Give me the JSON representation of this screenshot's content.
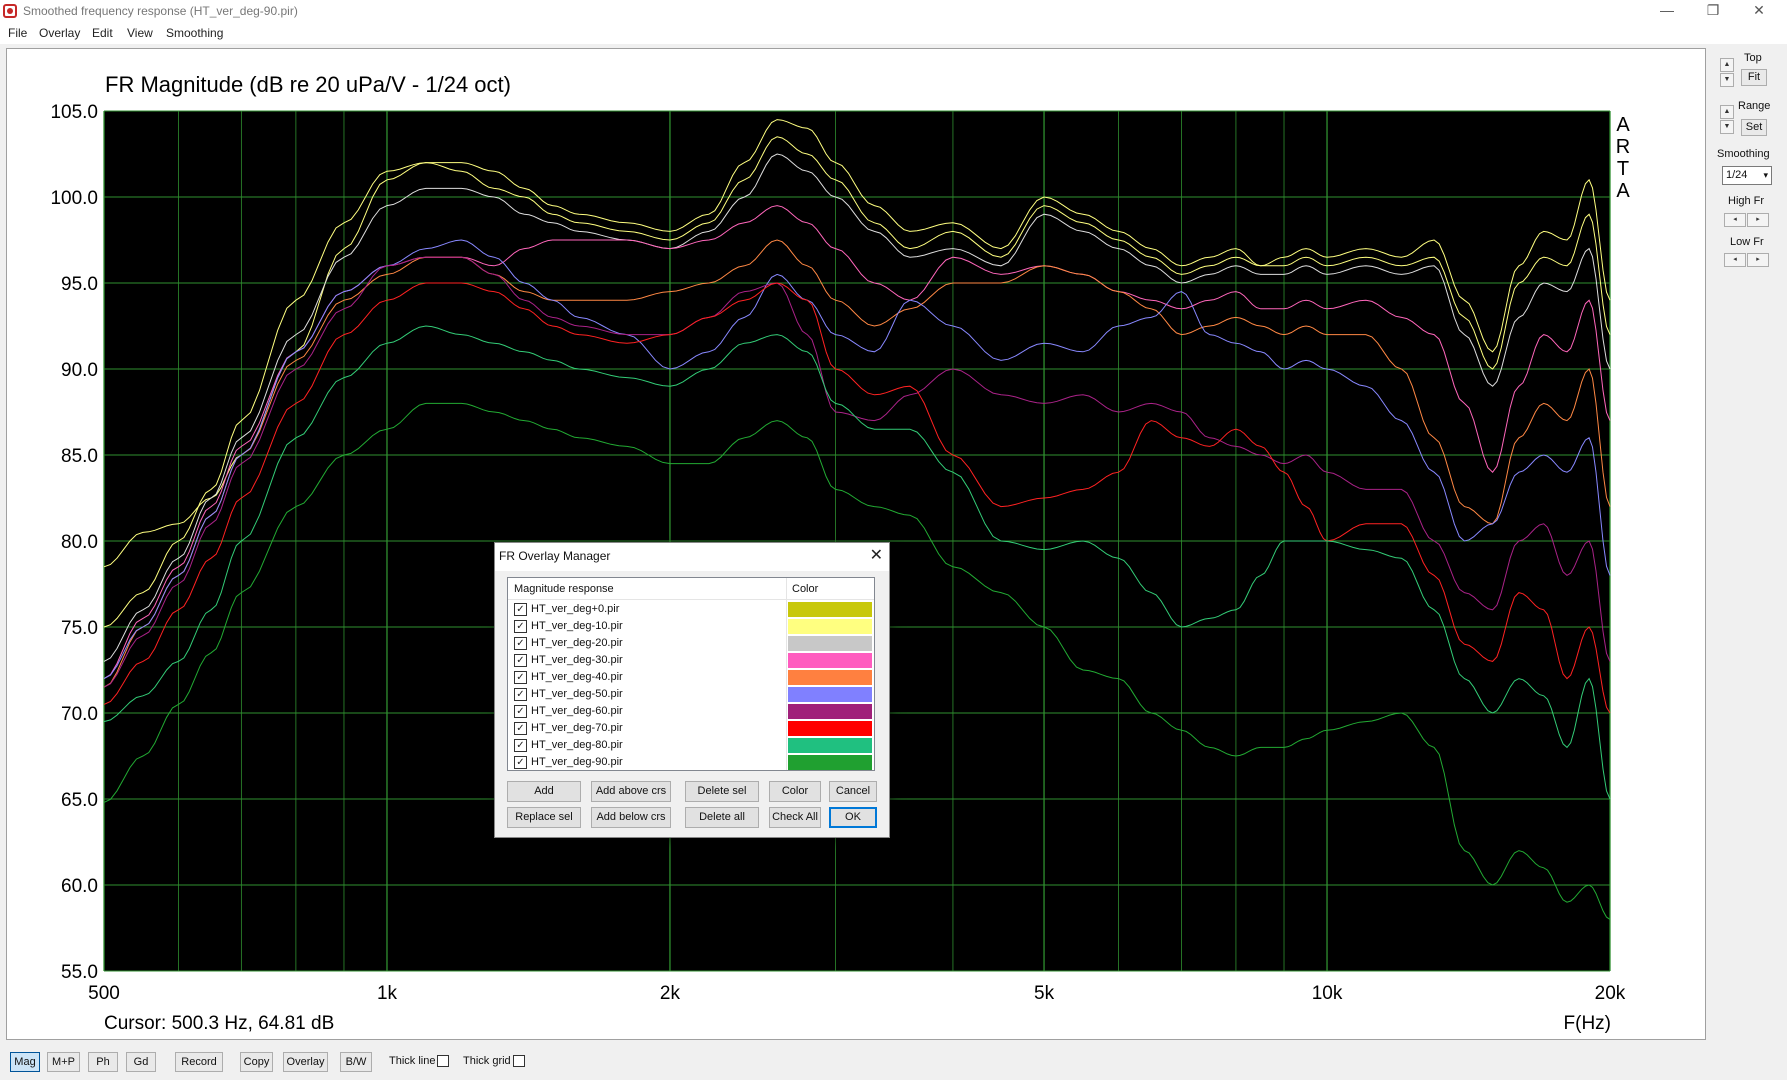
{
  "window": {
    "title": "Smoothed frequency response (HT_ver_deg-90.pir)",
    "controls": [
      "—",
      "❐",
      "✕"
    ]
  },
  "menu": [
    "File",
    "Overlay",
    "Edit",
    "View",
    "Smoothing"
  ],
  "chart_data": {
    "type": "line",
    "title": "FR Magnitude (dB re 20 uPa/V - 1/24 oct)",
    "watermark": "ARTA",
    "xlabel": "F(Hz)",
    "ylabel": "",
    "x_scale": "log",
    "xlim": [
      500,
      20000
    ],
    "ylim": [
      55,
      105
    ],
    "x_ticks": [
      500,
      1000,
      2000,
      5000,
      10000,
      20000
    ],
    "x_tick_labels": [
      "500",
      "1k",
      "2k",
      "5k",
      "10k",
      "20k"
    ],
    "y_ticks": [
      55,
      60,
      65,
      70,
      75,
      80,
      85,
      90,
      95,
      100,
      105
    ],
    "y_tick_labels": [
      "55.0",
      "60.0",
      "65.0",
      "70.0",
      "75.0",
      "80.0",
      "85.0",
      "90.0",
      "95.0",
      "100.0",
      "105.0"
    ],
    "grid": true,
    "background": "#000000",
    "grid_color": "#2f8f2f",
    "cursor_text": "Cursor: 500.3 Hz, 64.81 dB",
    "x": [
      500,
      550,
      600,
      650,
      700,
      800,
      900,
      1000,
      1100,
      1200,
      1300,
      1400,
      1500,
      1600,
      1800,
      2000,
      2200,
      2400,
      2600,
      2800,
      3000,
      3300,
      3600,
      4000,
      4500,
      5000,
      5500,
      6000,
      6500,
      7000,
      7500,
      8000,
      8500,
      9000,
      9500,
      10000,
      11000,
      12000,
      13000,
      14000,
      15000,
      16000,
      17000,
      18000,
      19000,
      20000
    ],
    "series": [
      {
        "name": "HT_ver_deg+0.pir",
        "color": "#ffff80",
        "values": [
          78.5,
          80.5,
          81,
          82.5,
          85,
          91,
          97,
          101,
          102,
          102,
          101.5,
          100.5,
          99.5,
          99,
          98.5,
          98,
          99,
          102,
          104.5,
          104,
          102,
          99.5,
          98,
          98.5,
          97,
          100,
          99,
          98,
          97,
          96,
          96.5,
          97,
          96,
          96.5,
          97,
          96.5,
          97,
          96.5,
          97.5,
          94,
          91,
          96,
          98,
          97.5,
          101,
          94
        ]
      },
      {
        "name": "HT_ver_deg-10.pir",
        "color": "#ffff80",
        "values": [
          75,
          77,
          80,
          83,
          87,
          94,
          98.5,
          101.5,
          102,
          101.5,
          100.5,
          100,
          99,
          98.5,
          98,
          97.5,
          98.5,
          101,
          103.5,
          102.5,
          101,
          98.5,
          97,
          98,
          96.5,
          99.5,
          98.5,
          97.5,
          96.5,
          95.5,
          96,
          96.5,
          96,
          96,
          96.5,
          96,
          96.5,
          96,
          96.5,
          93,
          90,
          95,
          96.5,
          96,
          99,
          92
        ]
      },
      {
        "name": "HT_ver_deg-20.pir",
        "color": "#dddddd",
        "values": [
          73,
          76,
          79,
          82.5,
          86,
          92,
          96.5,
          99.5,
          100.5,
          100.5,
          100,
          99,
          98.5,
          98,
          97.5,
          97,
          98,
          100,
          102.5,
          101.5,
          100,
          98,
          96.5,
          97,
          96,
          99,
          98,
          97,
          96,
          95,
          95.5,
          96,
          95.5,
          95.5,
          96,
          95.5,
          96,
          95.5,
          96,
          92,
          89,
          93,
          95,
          94.5,
          97,
          90
        ]
      },
      {
        "name": "HT_ver_deg-30.pir",
        "color": "#ff66bb",
        "values": [
          72,
          75.5,
          78.5,
          82,
          85.5,
          91,
          94.5,
          96,
          96.5,
          96.5,
          96,
          97,
          97.5,
          97.5,
          97.5,
          97,
          97.5,
          98.5,
          99.5,
          98.5,
          97,
          95,
          94,
          96.5,
          95.5,
          96,
          95.5,
          94.5,
          94,
          93.5,
          94,
          94.5,
          93.5,
          93.5,
          94,
          93.5,
          94,
          93,
          92,
          88,
          84,
          89,
          92,
          91,
          94,
          87
        ]
      },
      {
        "name": "HT_ver_deg-40.pir",
        "color": "#ff8844",
        "values": [
          71.5,
          75,
          78,
          81.5,
          85,
          90.5,
          94,
          95.5,
          96.5,
          96.5,
          95.5,
          94.5,
          94,
          94,
          94,
          94.5,
          95,
          96,
          97.5,
          96,
          94,
          92.5,
          93.5,
          95,
          95,
          96,
          95.5,
          94.5,
          93.5,
          92,
          92.5,
          93,
          92.5,
          92,
          92.5,
          92,
          92,
          90,
          86,
          82,
          81,
          86,
          88,
          87,
          90,
          82
        ]
      },
      {
        "name": "HT_ver_deg-50.pir",
        "color": "#8888ff",
        "values": [
          72,
          75,
          78,
          81.5,
          85,
          91,
          94.5,
          96,
          97,
          97.5,
          96.5,
          95,
          94,
          93,
          92,
          90,
          91,
          93,
          95.5,
          94,
          92,
          91,
          94,
          92.5,
          90.5,
          91.5,
          91,
          92.5,
          93,
          94.5,
          92,
          91.5,
          91,
          90,
          90.5,
          90,
          89,
          87,
          84,
          80,
          81,
          84,
          85,
          84,
          86,
          78
        ]
      },
      {
        "name": "HT_ver_deg-60.pir",
        "color": "#aa2288",
        "values": [
          71.5,
          74.5,
          77.5,
          81,
          84.5,
          90,
          93.5,
          96,
          96.5,
          96.5,
          95.5,
          94,
          93,
          92.5,
          92,
          92,
          93,
          94.5,
          95,
          92,
          87.5,
          87,
          88.5,
          90,
          88.5,
          88,
          88.5,
          87.5,
          88,
          87.5,
          86,
          85.5,
          85,
          84.5,
          85,
          84,
          83,
          83,
          80,
          77,
          76,
          80,
          81,
          78,
          80,
          73
        ]
      },
      {
        "name": "HT_ver_deg-70.pir",
        "color": "#ff2222",
        "values": [
          70.5,
          73,
          76,
          79,
          82.5,
          88,
          92,
          94,
          95,
          95,
          94.5,
          93.5,
          92.5,
          92,
          91.5,
          92,
          93,
          94,
          95,
          94,
          90,
          88.5,
          89,
          85,
          82,
          82.5,
          83,
          84,
          87,
          86,
          85.5,
          86.5,
          85.5,
          84,
          82,
          80,
          81,
          81,
          78,
          74,
          73,
          77,
          76,
          72,
          75,
          70
        ]
      },
      {
        "name": "HT_ver_deg-80.pir",
        "color": "#33cc77",
        "values": [
          69.5,
          71,
          73,
          76,
          80,
          86,
          89.5,
          91.5,
          92.5,
          92,
          91.5,
          91,
          90.5,
          90,
          89.5,
          89,
          90,
          91.5,
          92,
          91,
          88,
          86.5,
          86.5,
          84,
          80,
          79.5,
          80,
          79,
          77,
          75,
          75.5,
          76,
          78,
          80,
          80,
          80,
          79.5,
          79,
          76,
          72,
          70,
          72,
          71,
          68,
          72,
          65
        ]
      },
      {
        "name": "HT_ver_deg-90.pir",
        "color": "#22aa33",
        "values": [
          64.8,
          67.5,
          70.5,
          73.5,
          77,
          82,
          85,
          86.5,
          88,
          88,
          87.5,
          87,
          86.5,
          86,
          85.5,
          84.5,
          84.5,
          86,
          87,
          86,
          83,
          82,
          81.5,
          78.5,
          77,
          75,
          72.5,
          72,
          70,
          69,
          68,
          67.5,
          68,
          68,
          68.5,
          69,
          69.5,
          70,
          68,
          62,
          60,
          62,
          61,
          59,
          60,
          58
        ]
      }
    ]
  },
  "right_panel": {
    "top_label": "Top",
    "fit_label": "Fit",
    "range_label": "Range",
    "set_label": "Set",
    "smoothing_label": "Smoothing",
    "smoothing_value": "1/24",
    "high_fr_label": "High Fr",
    "low_fr_label": "Low Fr"
  },
  "dialog": {
    "title": "FR Overlay Manager",
    "col_name": "Magnitude response",
    "col_color": "Color",
    "rows": [
      {
        "name": "HT_ver_deg+0.pir",
        "color": "#c8c80a",
        "checked": true
      },
      {
        "name": "HT_ver_deg-10.pir",
        "color": "#ffff80",
        "checked": true
      },
      {
        "name": "HT_ver_deg-20.pir",
        "color": "#c8c8c8",
        "checked": true
      },
      {
        "name": "HT_ver_deg-30.pir",
        "color": "#ff5cbf",
        "checked": true
      },
      {
        "name": "HT_ver_deg-40.pir",
        "color": "#ff8040",
        "checked": true
      },
      {
        "name": "HT_ver_deg-50.pir",
        "color": "#8080ff",
        "checked": true
      },
      {
        "name": "HT_ver_deg-60.pir",
        "color": "#a0207a",
        "checked": true
      },
      {
        "name": "HT_ver_deg-70.pir",
        "color": "#ff0000",
        "checked": true
      },
      {
        "name": "HT_ver_deg-80.pir",
        "color": "#20c080",
        "checked": true
      },
      {
        "name": "HT_ver_deg-90.pir",
        "color": "#20a030",
        "checked": true
      }
    ],
    "buttons": {
      "add": "Add",
      "add_above": "Add above crs",
      "delete_sel": "Delete sel",
      "color": "Color",
      "cancel": "Cancel",
      "replace_sel": "Replace sel",
      "add_below": "Add below crs",
      "delete_all": "Delete all",
      "check_all": "Check All",
      "ok": "OK"
    }
  },
  "statusbar": {
    "mag": "Mag",
    "mp": "M+P",
    "ph": "Ph",
    "gd": "Gd",
    "record": "Record",
    "copy": "Copy",
    "overlay": "Overlay",
    "bw": "B/W",
    "thick_line": "Thick line",
    "thick_grid": "Thick grid"
  }
}
